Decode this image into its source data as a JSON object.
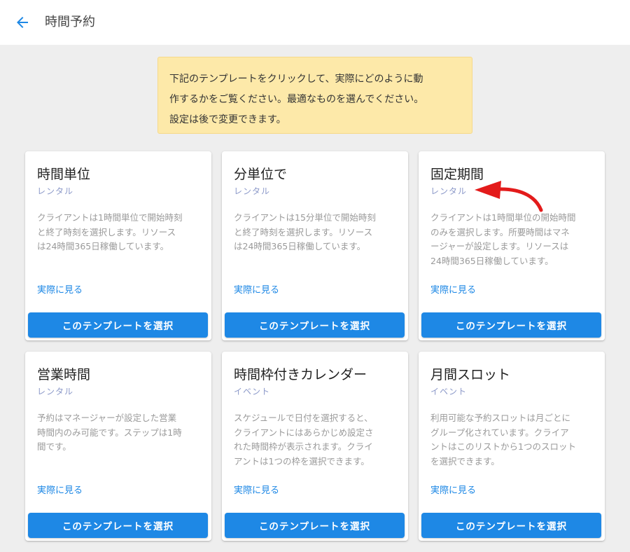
{
  "header": {
    "back_icon": "arrow-left-icon",
    "title": "時間予約"
  },
  "notice": {
    "line1": "下記のテンプレートをクリックして、実際にどのように動",
    "line2": "作するかをご覧ください。最適なものを選んでください。",
    "line3": "設定は後で変更できます。"
  },
  "colors": {
    "accent": "#1e88e5",
    "notice_bg": "#fde9a9",
    "annotation_arrow": "#e31b1b"
  },
  "templates": [
    {
      "title": "時間単位",
      "subtitle": "レンタル",
      "desc": [
        "クライアントは1時間単位で開始時刻",
        "と終了時刻を選択します。リソース",
        "は24時間365日稼働しています。"
      ],
      "link": "実際に見る",
      "button": "このテンプレートを選択"
    },
    {
      "title": "分単位で",
      "subtitle": "レンタル",
      "desc": [
        "クライアントは15分単位で開始時刻",
        "と終了時刻を選択します。リソース",
        "は24時間365日稼働しています。"
      ],
      "link": "実際に見る",
      "button": "このテンプレートを選択"
    },
    {
      "title": "固定期間",
      "subtitle": "レンタル",
      "desc": [
        "クライアントは1時間単位の開始時間",
        "のみを選択します。所要時間はマネ",
        "ージャーが設定します。リソースは",
        "24時間365日稼働しています。"
      ],
      "link": "実際に見る",
      "button": "このテンプレートを選択"
    },
    {
      "title": "営業時間",
      "subtitle": "レンタル",
      "desc": [
        "予約はマネージャーが設定した営業",
        "時間内のみ可能です。ステップは1時",
        "間です。"
      ],
      "link": "実際に見る",
      "button": "このテンプレートを選択"
    },
    {
      "title": "時間枠付きカレンダー",
      "subtitle": "イベント",
      "desc": [
        "スケジュールで日付を選択すると、",
        "クライアントにはあらかじめ設定さ",
        "れた時間枠が表示されます。クライ",
        "アントは1つの枠を選択できます。"
      ],
      "link": "実際に見る",
      "button": "このテンプレートを選択"
    },
    {
      "title": "月間スロット",
      "subtitle": "イベント",
      "desc": [
        "利用可能な予約スロットは月ごとに",
        "グループ化されています。クライア",
        "ントはこのリストから1つのスロット",
        "を選択できます。"
      ],
      "link": "実際に見る",
      "button": "このテンプレートを選択"
    }
  ]
}
